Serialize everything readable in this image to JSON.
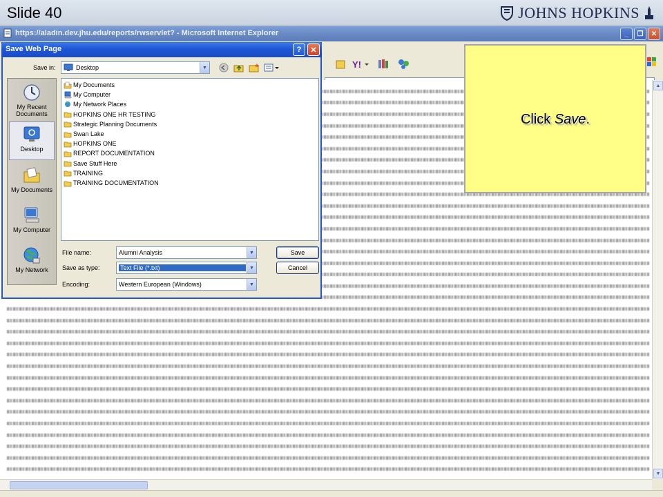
{
  "slide": {
    "title": "Slide 40",
    "logo_text": "JOHNS HOPKINS"
  },
  "browser": {
    "title": "https://aladin.dev.jhu.edu/reports/rwservlet? - Microsoft Internet Explorer",
    "controls": {
      "minimize": "_",
      "maximize": "❐",
      "close": "✕"
    }
  },
  "dialog": {
    "title": "Save Web Page",
    "help_label": "?",
    "close_label": "✕",
    "save_in_label": "Save in:",
    "save_in_value": "Desktop",
    "places": [
      {
        "label": "My Recent Documents",
        "icon": "recent-documents-icon"
      },
      {
        "label": "Desktop",
        "icon": "desktop-icon"
      },
      {
        "label": "My Documents",
        "icon": "my-documents-icon"
      },
      {
        "label": "My Computer",
        "icon": "my-computer-icon"
      },
      {
        "label": "My Network",
        "icon": "my-network-icon"
      }
    ],
    "files": [
      {
        "name": "My Documents",
        "icon": "my-documents-icon"
      },
      {
        "name": "My Computer",
        "icon": "my-computer-icon"
      },
      {
        "name": "My Network Places",
        "icon": "network-places-icon"
      },
      {
        "name": "HOPKINS ONE HR TESTING",
        "icon": "folder-icon"
      },
      {
        "name": "Strategic Planning Documents",
        "icon": "folder-icon"
      },
      {
        "name": "Swan Lake",
        "icon": "folder-icon"
      },
      {
        "name": "HOPKINS ONE",
        "icon": "folder-icon"
      },
      {
        "name": "REPORT DOCUMENTATION",
        "icon": "folder-icon"
      },
      {
        "name": "Save Stuff Here",
        "icon": "folder-icon"
      },
      {
        "name": "TRAINING",
        "icon": "folder-icon"
      },
      {
        "name": "TRAINING DOCUMENTATION",
        "icon": "folder-icon"
      }
    ],
    "file_name_label": "File name:",
    "file_name_value": "Alumni Analysis",
    "save_as_type_label": "Save as type:",
    "save_as_type_value": "Text File (*.txt)",
    "encoding_label": "Encoding:",
    "encoding_value": "Western European (Windows)",
    "save_button": "Save",
    "cancel_button": "Cancel"
  },
  "callout": {
    "text_prefix": "Click ",
    "text_emphasis": "Save",
    "text_suffix": "."
  },
  "colors": {
    "callout_bg": "#ffff88",
    "dialog_title": "#1f56d6",
    "selection": "#316ac5"
  }
}
